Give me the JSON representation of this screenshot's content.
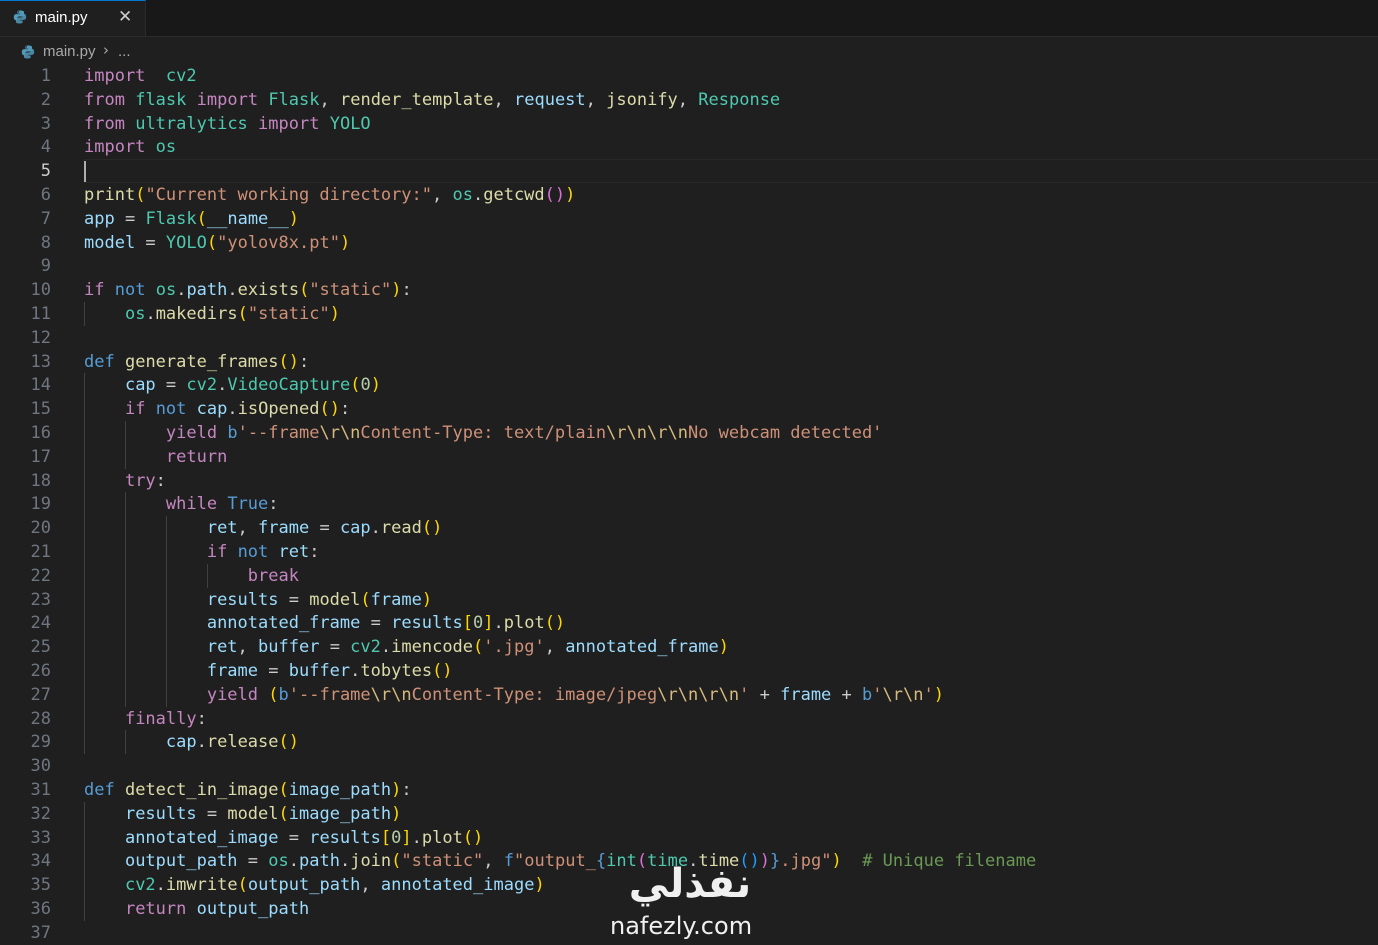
{
  "tab": {
    "filename": "main.py",
    "close_glyph": "✕"
  },
  "breadcrumb": {
    "file": "main.py",
    "separator": "›",
    "more": "..."
  },
  "editor": {
    "active_line": 5,
    "line_numbers": [
      "1",
      "2",
      "3",
      "4",
      "5",
      "6",
      "7",
      "8",
      "9",
      "10",
      "11",
      "12",
      "13",
      "14",
      "15",
      "16",
      "17",
      "18",
      "19",
      "20",
      "21",
      "22",
      "23",
      "24",
      "25",
      "26",
      "27",
      "28",
      "29",
      "30",
      "31",
      "32",
      "33",
      "34",
      "35",
      "36",
      "37"
    ],
    "lines": [
      [
        [
          "kw",
          "import"
        ],
        [
          "",
          "  "
        ],
        [
          "cl",
          "cv2"
        ]
      ],
      [
        [
          "kw",
          "from"
        ],
        [
          "",
          " "
        ],
        [
          "cl",
          "flask"
        ],
        [
          "",
          " "
        ],
        [
          "kw",
          "import"
        ],
        [
          "",
          " "
        ],
        [
          "cl",
          "Flask"
        ],
        [
          "",
          ", "
        ],
        [
          "fn",
          "render_template"
        ],
        [
          "",
          ", "
        ],
        [
          "vr",
          "request"
        ],
        [
          "",
          ", "
        ],
        [
          "fn",
          "jsonify"
        ],
        [
          "",
          ", "
        ],
        [
          "cl",
          "Response"
        ]
      ],
      [
        [
          "kw",
          "from"
        ],
        [
          "",
          " "
        ],
        [
          "cl",
          "ultralytics"
        ],
        [
          "",
          " "
        ],
        [
          "kw",
          "import"
        ],
        [
          "",
          " "
        ],
        [
          "cl",
          "YOLO"
        ]
      ],
      [
        [
          "kw",
          "import"
        ],
        [
          "",
          " "
        ],
        [
          "cl",
          "os"
        ]
      ],
      [],
      [
        [
          "fn",
          "print"
        ],
        [
          "b1",
          "("
        ],
        [
          "st",
          "\"Current working directory:\""
        ],
        [
          "",
          ", "
        ],
        [
          "cl",
          "os"
        ],
        [
          "",
          "."
        ],
        [
          "fn",
          "getcwd"
        ],
        [
          "b2",
          "()"
        ],
        [
          "b1",
          ")"
        ]
      ],
      [
        [
          "vr",
          "app"
        ],
        [
          "",
          " = "
        ],
        [
          "cl",
          "Flask"
        ],
        [
          "b1",
          "("
        ],
        [
          "vr",
          "__name__"
        ],
        [
          "b1",
          ")"
        ]
      ],
      [
        [
          "vr",
          "model"
        ],
        [
          "",
          " = "
        ],
        [
          "cl",
          "YOLO"
        ],
        [
          "b1",
          "("
        ],
        [
          "st",
          "\"yolov8x.pt\""
        ],
        [
          "b1",
          ")"
        ]
      ],
      [],
      [
        [
          "kw",
          "if"
        ],
        [
          "",
          " "
        ],
        [
          "kb",
          "not"
        ],
        [
          "",
          " "
        ],
        [
          "cl",
          "os"
        ],
        [
          "",
          "."
        ],
        [
          "vr",
          "path"
        ],
        [
          "",
          "."
        ],
        [
          "fn",
          "exists"
        ],
        [
          "b1",
          "("
        ],
        [
          "st",
          "\"static\""
        ],
        [
          "b1",
          ")"
        ],
        [
          "",
          ":"
        ]
      ],
      [
        [
          "",
          "    "
        ],
        [
          "cl",
          "os"
        ],
        [
          "",
          "."
        ],
        [
          "fn",
          "makedirs"
        ],
        [
          "b1",
          "("
        ],
        [
          "st",
          "\"static\""
        ],
        [
          "b1",
          ")"
        ]
      ],
      [],
      [
        [
          "kb",
          "def"
        ],
        [
          "",
          " "
        ],
        [
          "fn",
          "generate_frames"
        ],
        [
          "b1",
          "()"
        ],
        [
          "",
          ":"
        ]
      ],
      [
        [
          "",
          "    "
        ],
        [
          "vr",
          "cap"
        ],
        [
          "",
          " = "
        ],
        [
          "cl",
          "cv2"
        ],
        [
          "",
          "."
        ],
        [
          "cl",
          "VideoCapture"
        ],
        [
          "b1",
          "("
        ],
        [
          "nm",
          "0"
        ],
        [
          "b1",
          ")"
        ]
      ],
      [
        [
          "",
          "    "
        ],
        [
          "kw",
          "if"
        ],
        [
          "",
          " "
        ],
        [
          "kb",
          "not"
        ],
        [
          "",
          " "
        ],
        [
          "vr",
          "cap"
        ],
        [
          "",
          "."
        ],
        [
          "fn",
          "isOpened"
        ],
        [
          "b1",
          "()"
        ],
        [
          "",
          ":"
        ]
      ],
      [
        [
          "",
          "        "
        ],
        [
          "kw",
          "yield"
        ],
        [
          "",
          " "
        ],
        [
          "kb",
          "b"
        ],
        [
          "st",
          "'--frame"
        ],
        [
          "es",
          "\\r\\n"
        ],
        [
          "st",
          "Content-Type: text/plain"
        ],
        [
          "es",
          "\\r\\n\\r\\n"
        ],
        [
          "st",
          "No webcam detected'"
        ]
      ],
      [
        [
          "",
          "        "
        ],
        [
          "kw",
          "return"
        ]
      ],
      [
        [
          "",
          "    "
        ],
        [
          "kw",
          "try"
        ],
        [
          "",
          ":"
        ]
      ],
      [
        [
          "",
          "        "
        ],
        [
          "kw",
          "while"
        ],
        [
          "",
          " "
        ],
        [
          "kb",
          "True"
        ],
        [
          "",
          ":"
        ]
      ],
      [
        [
          "",
          "            "
        ],
        [
          "vr",
          "ret"
        ],
        [
          "",
          ", "
        ],
        [
          "vr",
          "frame"
        ],
        [
          "",
          " = "
        ],
        [
          "vr",
          "cap"
        ],
        [
          "",
          "."
        ],
        [
          "fn",
          "read"
        ],
        [
          "b1",
          "()"
        ]
      ],
      [
        [
          "",
          "            "
        ],
        [
          "kw",
          "if"
        ],
        [
          "",
          " "
        ],
        [
          "kb",
          "not"
        ],
        [
          "",
          " "
        ],
        [
          "vr",
          "ret"
        ],
        [
          "",
          ":"
        ]
      ],
      [
        [
          "",
          "                "
        ],
        [
          "kw",
          "break"
        ]
      ],
      [
        [
          "",
          "            "
        ],
        [
          "vr",
          "results"
        ],
        [
          "",
          " = "
        ],
        [
          "fn",
          "model"
        ],
        [
          "b1",
          "("
        ],
        [
          "vr",
          "frame"
        ],
        [
          "b1",
          ")"
        ]
      ],
      [
        [
          "",
          "            "
        ],
        [
          "vr",
          "annotated_frame"
        ],
        [
          "",
          " = "
        ],
        [
          "vr",
          "results"
        ],
        [
          "b1",
          "["
        ],
        [
          "nm",
          "0"
        ],
        [
          "b1",
          "]"
        ],
        [
          "",
          "."
        ],
        [
          "fn",
          "plot"
        ],
        [
          "b1",
          "()"
        ]
      ],
      [
        [
          "",
          "            "
        ],
        [
          "vr",
          "ret"
        ],
        [
          "",
          ", "
        ],
        [
          "vr",
          "buffer"
        ],
        [
          "",
          " = "
        ],
        [
          "cl",
          "cv2"
        ],
        [
          "",
          "."
        ],
        [
          "fn",
          "imencode"
        ],
        [
          "b1",
          "("
        ],
        [
          "st",
          "'.jpg'"
        ],
        [
          "",
          ", "
        ],
        [
          "vr",
          "annotated_frame"
        ],
        [
          "b1",
          ")"
        ]
      ],
      [
        [
          "",
          "            "
        ],
        [
          "vr",
          "frame"
        ],
        [
          "",
          " = "
        ],
        [
          "vr",
          "buffer"
        ],
        [
          "",
          "."
        ],
        [
          "fn",
          "tobytes"
        ],
        [
          "b1",
          "()"
        ]
      ],
      [
        [
          "",
          "            "
        ],
        [
          "kw",
          "yield"
        ],
        [
          "",
          " "
        ],
        [
          "b1",
          "("
        ],
        [
          "kb",
          "b"
        ],
        [
          "st",
          "'--frame"
        ],
        [
          "es",
          "\\r\\n"
        ],
        [
          "st",
          "Content-Type: image/jpeg"
        ],
        [
          "es",
          "\\r\\n\\r\\n"
        ],
        [
          "st",
          "'"
        ],
        [
          "",
          " + "
        ],
        [
          "vr",
          "frame"
        ],
        [
          "",
          " + "
        ],
        [
          "kb",
          "b"
        ],
        [
          "st",
          "'"
        ],
        [
          "es",
          "\\r\\n"
        ],
        [
          "st",
          "'"
        ],
        [
          "b1",
          ")"
        ]
      ],
      [
        [
          "",
          "    "
        ],
        [
          "kw",
          "finally"
        ],
        [
          "",
          ":"
        ]
      ],
      [
        [
          "",
          "        "
        ],
        [
          "vr",
          "cap"
        ],
        [
          "",
          "."
        ],
        [
          "fn",
          "release"
        ],
        [
          "b1",
          "()"
        ]
      ],
      [],
      [
        [
          "kb",
          "def"
        ],
        [
          "",
          " "
        ],
        [
          "fn",
          "detect_in_image"
        ],
        [
          "b1",
          "("
        ],
        [
          "vr",
          "image_path"
        ],
        [
          "b1",
          ")"
        ],
        [
          "",
          ":"
        ]
      ],
      [
        [
          "",
          "    "
        ],
        [
          "vr",
          "results"
        ],
        [
          "",
          " = "
        ],
        [
          "fn",
          "model"
        ],
        [
          "b1",
          "("
        ],
        [
          "vr",
          "image_path"
        ],
        [
          "b1",
          ")"
        ]
      ],
      [
        [
          "",
          "    "
        ],
        [
          "vr",
          "annotated_image"
        ],
        [
          "",
          " = "
        ],
        [
          "vr",
          "results"
        ],
        [
          "b1",
          "["
        ],
        [
          "nm",
          "0"
        ],
        [
          "b1",
          "]"
        ],
        [
          "",
          "."
        ],
        [
          "fn",
          "plot"
        ],
        [
          "b1",
          "()"
        ]
      ],
      [
        [
          "",
          "    "
        ],
        [
          "vr",
          "output_path"
        ],
        [
          "",
          " = "
        ],
        [
          "cl",
          "os"
        ],
        [
          "",
          "."
        ],
        [
          "vr",
          "path"
        ],
        [
          "",
          "."
        ],
        [
          "fn",
          "join"
        ],
        [
          "b1",
          "("
        ],
        [
          "st",
          "\"static\""
        ],
        [
          "",
          ", "
        ],
        [
          "kb",
          "f"
        ],
        [
          "st",
          "\"output_"
        ],
        [
          "kb",
          "{"
        ],
        [
          "cl",
          "int"
        ],
        [
          "b2",
          "("
        ],
        [
          "cl",
          "time"
        ],
        [
          "",
          "."
        ],
        [
          "fn",
          "time"
        ],
        [
          "b3",
          "()"
        ],
        [
          "b2",
          ")"
        ],
        [
          "kb",
          "}"
        ],
        [
          "st",
          ".jpg\""
        ],
        [
          "b1",
          ")"
        ],
        [
          "",
          "  "
        ],
        [
          "cm",
          "# Unique filename"
        ]
      ],
      [
        [
          "",
          "    "
        ],
        [
          "cl",
          "cv2"
        ],
        [
          "",
          "."
        ],
        [
          "fn",
          "imwrite"
        ],
        [
          "b1",
          "("
        ],
        [
          "vr",
          "output_path"
        ],
        [
          "",
          ", "
        ],
        [
          "vr",
          "annotated_image"
        ],
        [
          "b1",
          ")"
        ]
      ],
      [
        [
          "",
          "    "
        ],
        [
          "kw",
          "return"
        ],
        [
          "",
          " "
        ],
        [
          "vr",
          "output_path"
        ]
      ],
      []
    ]
  },
  "watermark": {
    "arabic": "نفذلي",
    "url": "nafezly.com"
  },
  "colors": {
    "background": "#1f1f1f",
    "keyword_control": "#c586c0",
    "keyword": "#569cd6",
    "function": "#dcdcaa",
    "variable": "#9cdcfe",
    "class": "#4ec9b0",
    "string": "#ce9178",
    "number": "#b5cea8",
    "comment": "#6a9955"
  }
}
